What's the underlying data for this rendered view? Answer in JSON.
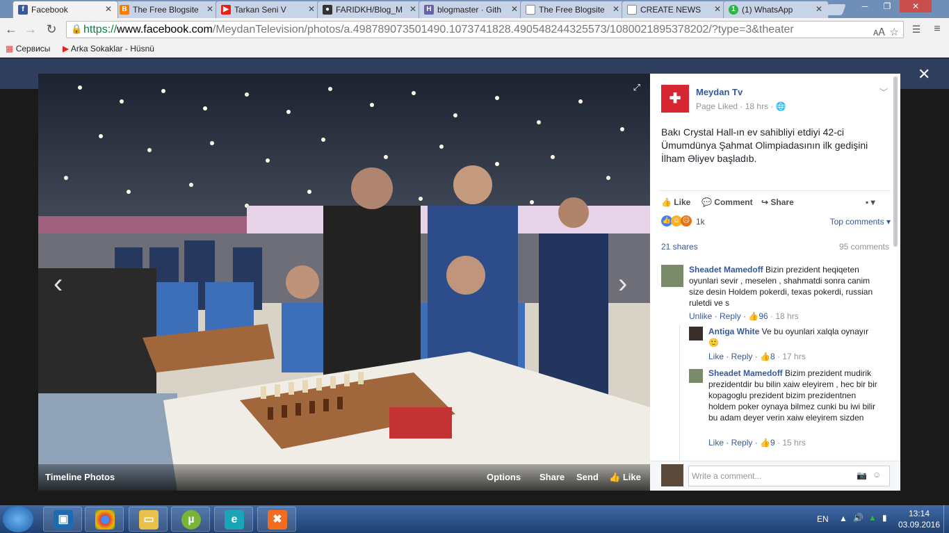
{
  "browser": {
    "tabs": [
      {
        "title": "Facebook",
        "favicon": "facebook-icon",
        "color": "#3b5998",
        "active": true
      },
      {
        "title": "The Free Blogsite",
        "favicon": "blogger-icon",
        "color": "#f57d00"
      },
      {
        "title": "Tarkan Seni V",
        "favicon": "youtube-icon",
        "color": "#e62117"
      },
      {
        "title": "FARIDKH/Blog_M",
        "favicon": "github-icon",
        "color": "#333"
      },
      {
        "title": "blogmaster · Gith",
        "favicon": "heroku-icon",
        "color": "#6762a6"
      },
      {
        "title": "The Free Blogsite",
        "favicon": "page-icon",
        "color": "#888"
      },
      {
        "title": "CREATE NEWS",
        "favicon": "page-icon",
        "color": "#888"
      },
      {
        "title": "(1) WhatsApp",
        "favicon": "whatsapp-icon",
        "color": "#2cb742"
      }
    ],
    "url_scheme": "https://",
    "url_host": "www.facebook.com",
    "url_path": "/MeydanTelevision/photos/a.498789073501490.1073741828.490548244325573/1080021895378202/?type=3&theater",
    "bookmarks": [
      {
        "label": "Сервисы",
        "icon": "apps-icon"
      },
      {
        "label": "Arka Sokaklar - Hüsnü",
        "icon": "youtube-icon"
      }
    ]
  },
  "photo": {
    "caption": "Timeline Photos",
    "actions": {
      "options": "Options",
      "share": "Share",
      "send": "Send",
      "like": "Like"
    }
  },
  "post": {
    "page_name": "Meydan Tv",
    "meta": "Page Liked · 18 hrs · ",
    "text": "Bakı Crystal Hall-ın ev sahibliyi etdiyi 42-ci Ümumdünya Şahmat Olimpiadasının ilk gedişini İlham Əliyev başladıb.",
    "like": "Like",
    "comment": "Comment",
    "share": "Share",
    "reactions_count": "1k",
    "top_comments": "Top comments",
    "shares": "21 shares",
    "comments_count": "95 comments",
    "write_placeholder": "Write a comment..."
  },
  "comments": [
    {
      "name": "Sheadet Mamedoff",
      "text": "Bizin prezident heqiqeten oyunlari sevir , meselen , shahmatdi sonra canim size desin Holdem pokerdi, texas pokerdi, russian ruletdi ve s",
      "actions": "Unlike · Reply · ",
      "likes": "96",
      "time": " · 18 hrs"
    },
    {
      "name": "Antiga White",
      "text": "Ve bu oyunlari xalqla oynayır",
      "actions": "Like · Reply · ",
      "likes": "8",
      "time": " · 17 hrs"
    },
    {
      "name": "Sheadet Mamedoff",
      "text": "Bizim prezident mudirik prezidentdir bu bilin xaiw eleyirem , hec bir bir kopagoglu prezident bizim prezidentnen holdem poker oynaya bilmez cunki bu iwi bilir bu adam deyer verin xaiw eleyirem sizden",
      "actions": "Like · Reply · ",
      "likes": "9",
      "time": " · 15 hrs"
    }
  ],
  "taskbar": {
    "lang": "EN",
    "time": "13:14",
    "date": "03.09.2016"
  }
}
